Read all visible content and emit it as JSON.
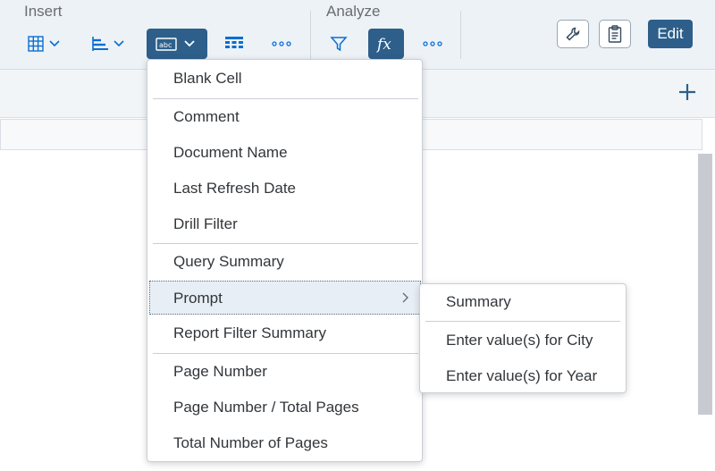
{
  "toolbar": {
    "insert_label": "Insert",
    "analyze_label": "Analyze",
    "edit_label": "Edit",
    "icons": {
      "table": "table-grid-icon",
      "chart": "bar-chart-icon",
      "cell": "text-cell-icon",
      "free_standing": "cell-matrix-icon",
      "more_insert": "more-dots-icon",
      "filter": "filter-funnel-icon",
      "formula": "fx-formula-icon",
      "more_analyze": "more-dots-icon",
      "tools": "wrench-icon",
      "clipboard": "clipboard-icon",
      "add": "plus-icon"
    }
  },
  "menu": {
    "items": [
      {
        "label": "Blank Cell"
      },
      {
        "label": "Comment"
      },
      {
        "label": "Document Name"
      },
      {
        "label": "Last Refresh Date"
      },
      {
        "label": "Drill Filter"
      },
      {
        "label": "Query Summary"
      },
      {
        "label": "Prompt",
        "has_submenu": true,
        "highlighted": true
      },
      {
        "label": "Report Filter Summary"
      },
      {
        "label": "Page Number"
      },
      {
        "label": "Page Number / Total Pages"
      },
      {
        "label": "Total Number of Pages"
      }
    ]
  },
  "submenu": {
    "items": [
      {
        "label": "Summary"
      },
      {
        "label": "Enter value(s) for City"
      },
      {
        "label": "Enter value(s) for Year"
      }
    ]
  },
  "colors": {
    "accent": "#0a6ed1",
    "active_button": "#2d5f8a",
    "toolbar_bg": "#edf2f7",
    "highlight_bg": "#e8eef5"
  }
}
